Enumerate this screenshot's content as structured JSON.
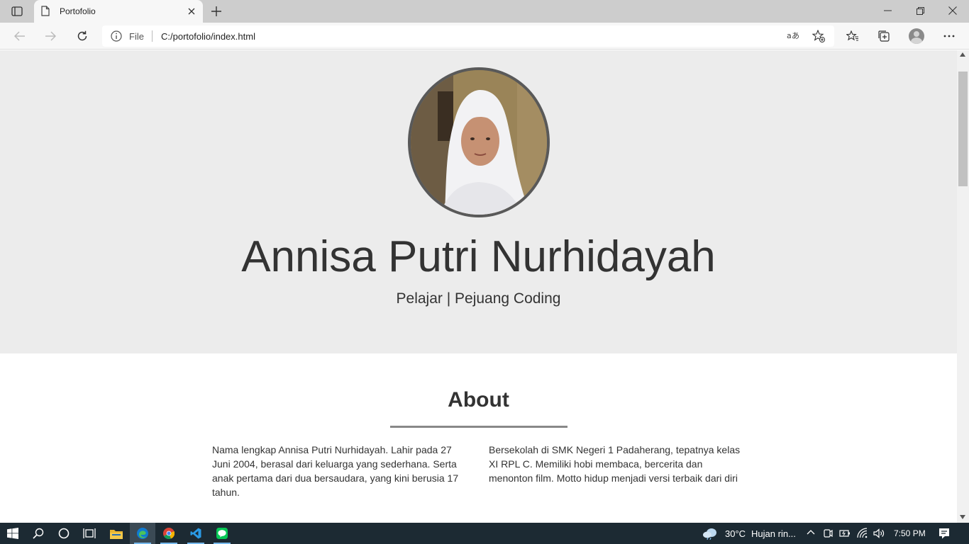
{
  "browser": {
    "tab": {
      "title": "Portofolio"
    },
    "address": {
      "scheme_label": "File",
      "url": "C:/portofolio/index.html"
    }
  },
  "page": {
    "hero": {
      "name": "Annisa Putri Nurhidayah",
      "tagline": "Pelajar | Pejuang Coding"
    },
    "about": {
      "title": "About",
      "left_text": "Nama lengkap Annisa Putri Nurhidayah. Lahir pada 27 Juni 2004, berasal dari keluarga yang sederhana. Serta anak pertama dari dua bersaudara, yang kini berusia 17 tahun.",
      "right_text": "Bersekolah di SMK Negeri 1 Padaherang, tepatnya kelas XI RPL C. Memiliki hobi membaca, bercerita dan menonton film. Motto hidup menjadi versi terbaik dari diri"
    }
  },
  "taskbar": {
    "apps": [
      "start-icon",
      "search-icon",
      "cortana-icon",
      "task-view-icon",
      "file-explorer-icon",
      "edge-icon",
      "chrome-icon",
      "vscode-icon",
      "line-icon"
    ],
    "weather": {
      "temp": "30°C",
      "condition": "Hujan rin..."
    },
    "clock": "7:50 PM"
  },
  "colors": {
    "hero_bg": "#ececec",
    "text": "#333333",
    "taskbar_bg": "#1c2a33",
    "accent_edge": "#0f7bd1"
  }
}
